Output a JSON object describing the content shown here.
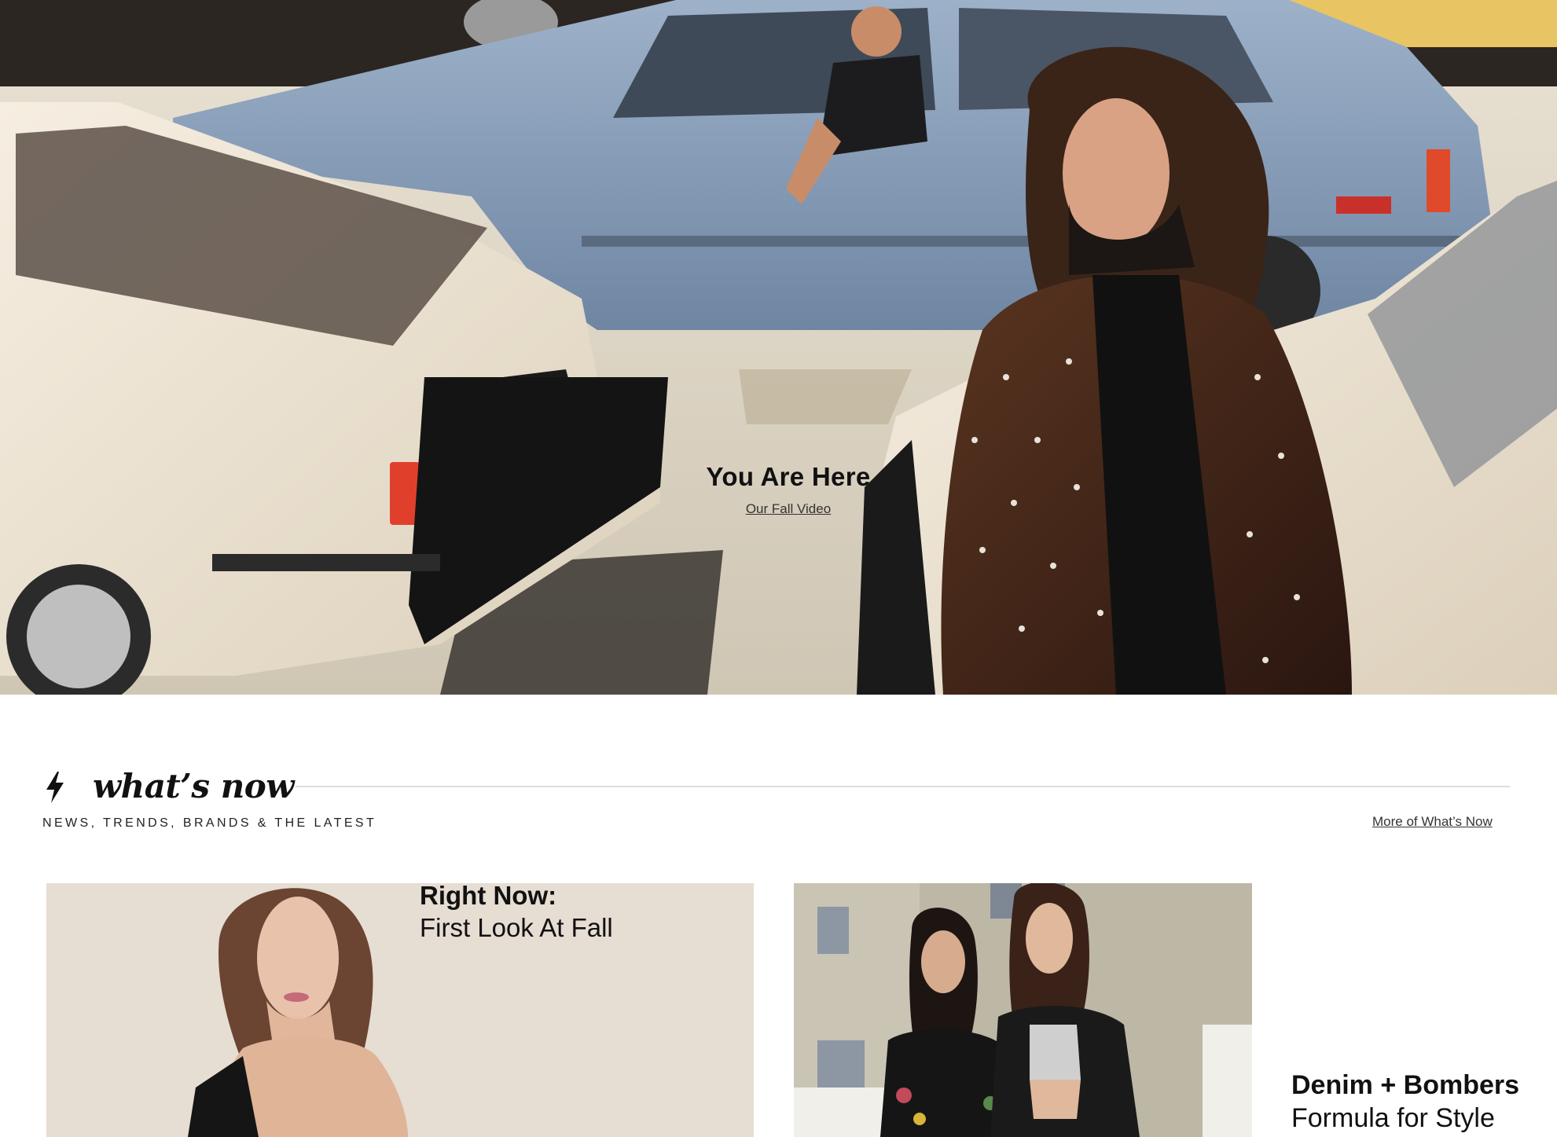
{
  "hero": {
    "title": "You Are Here",
    "link_label": "Our Fall Video"
  },
  "whats_now": {
    "icon": "lightning-bolt-icon",
    "title": "what’s now",
    "subtitle": "NEWS, TRENDS, BRANDS & THE LATEST",
    "more_link": "More of What’s Now",
    "cards": [
      {
        "heading": "Right Now:",
        "subheading": "First Look At Fall"
      },
      {
        "heading": "Denim + Bombers",
        "subheading": "Formula for Style"
      }
    ]
  },
  "colors": {
    "text": "#111111",
    "rule": "#dcdcdc",
    "background": "#ffffff"
  }
}
